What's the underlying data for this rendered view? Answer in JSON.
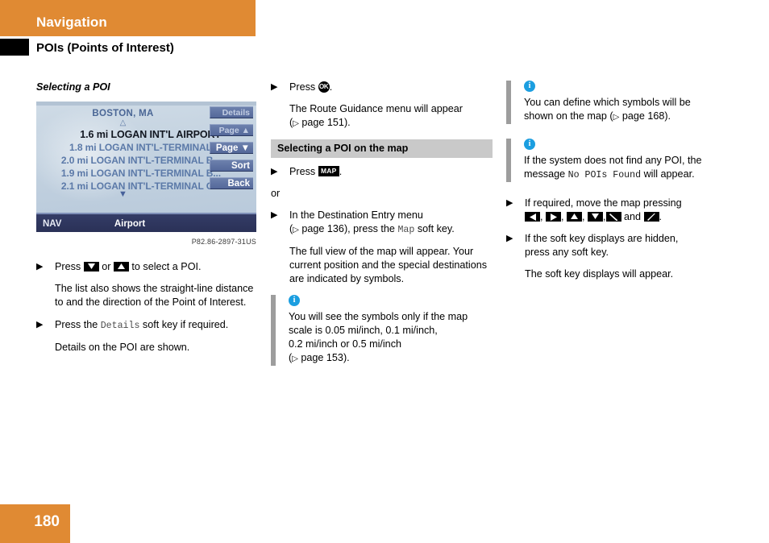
{
  "header": {
    "chapter": "Navigation",
    "section": "POIs (Points of Interest)"
  },
  "page": {
    "number": "180"
  },
  "colors": {
    "accent_orange": "#E08A33",
    "info_blue": "#1B9EE0",
    "note_bar_gray": "#9D9D9D",
    "subhead_band_gray": "#C9C9C9",
    "nav_softkey_blue": "#54689A",
    "nav_statusbar_navy": "#2A3157"
  },
  "left_column": {
    "subheading": "Selecting a POI",
    "nav_screen": {
      "city": "BOSTON, MA",
      "scroll_up_glyph": "△",
      "scroll_down_glyph": "▼",
      "list": [
        {
          "distance": "1.6 mi",
          "name": "LOGAN INT'L AIRPORT",
          "selected": true
        },
        {
          "distance": "1.8 mi",
          "name": "LOGAN INT'L-TERMINAL A",
          "selected": false
        },
        {
          "distance": "2.0 mi",
          "name": "LOGAN INT'L-TERMINAL B...",
          "selected": false
        },
        {
          "distance": "1.9 mi",
          "name": "LOGAN INT'L-TERMINAL B...",
          "selected": false
        },
        {
          "distance": "2.1 mi",
          "name": "LOGAN INT'L-TERMINAL C...",
          "selected": false
        }
      ],
      "soft_keys": [
        {
          "label": "Details"
        },
        {
          "label": "Page ▲"
        },
        {
          "label": "Page ▼"
        },
        {
          "label": "Sort"
        },
        {
          "label": "Back"
        }
      ],
      "status_bar": {
        "mode": "NAV",
        "category": "Airport"
      }
    },
    "figure_caption": "P82.86-2897-31US",
    "step1": {
      "pre": "Press",
      "mid": "or",
      "post": "to select a POI."
    },
    "step1_result": "The list also shows the straight-line distance to and the direction of the Point of Interest.",
    "step2": {
      "pre": "Press the",
      "key": "Details",
      "post": "soft key if required."
    },
    "step2_result": "Details on the POI are shown."
  },
  "middle_column": {
    "step1": {
      "pre": "Press",
      "key_icon": "ok-button-icon",
      "key_label": "OK",
      "post": "."
    },
    "step1_result_line1": "The Route Guidance menu will appear",
    "step1_result_line2_pre": "(",
    "step1_result_line2_ref": "page 151",
    "step1_result_line2_post": ").",
    "subheading": "Selecting a POI on the map",
    "step2": {
      "pre": "Press",
      "key_label": "MAP",
      "post": "."
    },
    "or_text": "or",
    "step3_line1": "In the Destination Entry menu",
    "step3_line2_pre": "(",
    "step3_line2_ref": "page 136",
    "step3_line2_mid": "), press the",
    "step3_line2_key": "Map",
    "step3_line2_post": "soft key.",
    "step3_result": "The full view of the map will appear. Your current position and the special destinations are indicated by symbols.",
    "note": {
      "line1": "You will see the symbols only if the map",
      "line2": "scale is 0.05 mi/inch, 0.1 mi/inch,",
      "line3": "0.2 mi/inch or 0.5 mi/inch",
      "line4_pre": "(",
      "line4_ref": "page 153",
      "line4_post": ")."
    }
  },
  "right_column": {
    "note1": {
      "line1": "You can define which symbols will be",
      "line2_pre": "shown on the map (",
      "line2_ref": "page 168",
      "line2_post": ")."
    },
    "note2": {
      "line1": "If the system does not find any POI, the",
      "line2_pre": "message",
      "line2_mono": "No POIs Found",
      "line2_post": "will appear."
    },
    "step1": {
      "line1": "If required, move the map pressing",
      "keys": [
        "left-arrow-key",
        "right-arrow-key",
        "up-arrow-key",
        "down-arrow-key",
        "diagonal-down-right-arrow-key",
        "diagonal-up-right-arrow-key"
      ],
      "and_word": "and",
      "end": "."
    },
    "step2_line1": "If the soft key displays are hidden,",
    "step2_line2": "press any soft key.",
    "step2_result": "The soft key displays will appear."
  }
}
